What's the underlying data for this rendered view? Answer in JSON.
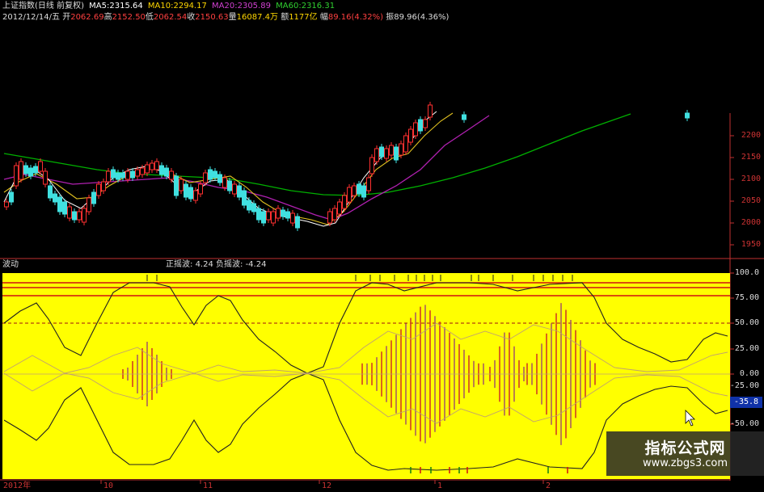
{
  "header": {
    "title": "上证指数(日线 前复权)",
    "ma5_label": "MA5:",
    "ma5": "2315.64",
    "ma10_label": "MA10:",
    "ma10": "2294.17",
    "ma20_label": "MA20:",
    "ma20": "2305.89",
    "ma60_label": "MA60:",
    "ma60": "2316.31",
    "date": "2012/12/14/五",
    "open_label": "开",
    "open": "2062.69",
    "high_label": "高",
    "high": "2152.50",
    "low_label": "低",
    "low": "2062.54",
    "close_label": "收",
    "close": "2150.63",
    "volume_label": "量",
    "volume": "16087.4万",
    "amount_label": "额",
    "amount": "1177亿",
    "change_label": "幅",
    "change": "89.16(4.32%)",
    "amplitude_label": "振",
    "amplitude": "89.96(4.36%)"
  },
  "price_axis": [
    "2200",
    "2150",
    "2100",
    "2050",
    "2000",
    "1950"
  ],
  "indicator": {
    "name": "波动",
    "positive_label": "正摇波:",
    "positive_value": "4.24",
    "negative_label": "负摇波:",
    "negative_value": "-4.24",
    "axis": [
      "100.0",
      "75.00",
      "50.00",
      "25.00",
      "0.00",
      "-25.00",
      "-50.00"
    ],
    "readout": "-35.8"
  },
  "dates": [
    "2012年",
    "10",
    "11",
    "12",
    "1",
    "2"
  ],
  "watermark": {
    "title": "指标公式网",
    "url": "www.zbgs3.com"
  },
  "colors": {
    "background": "#000000",
    "indicator_bg": "#ffff00",
    "up_candle": "#ff3030",
    "down_candle": "#40e0e0",
    "ma5": "#ffffff",
    "ma10": "#ffd700",
    "ma20": "#c020c0",
    "ma60": "#00c000",
    "axis": "#c03030"
  }
}
